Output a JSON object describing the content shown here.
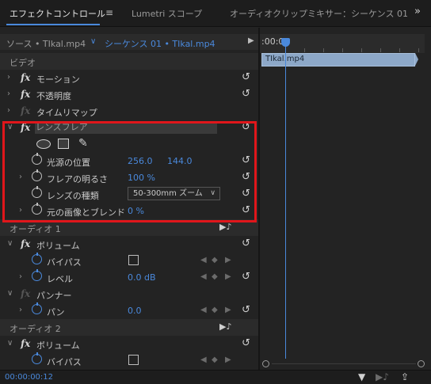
{
  "tabs": {
    "effect_controls": "エフェクトコントロール",
    "menu_icon": "≡",
    "lumetri": "Lumetri スコープ",
    "audio_mixer": "オーディオクリップミキサー：シーケンス 01",
    "more_icon": "»"
  },
  "source": {
    "label": "ソース • TIkal.mp4",
    "sequence": "シーケンス 01 • TIkal.mp4"
  },
  "sections": {
    "video": "ビデオ",
    "audio1": "オーディオ 1",
    "audio2": "オーディオ 2"
  },
  "effects": {
    "fx": "fx",
    "motion": "モーション",
    "opacity": "不透明度",
    "time_remap": "タイムリマップ",
    "lens_flare": "レンズフレア",
    "volume": "ボリューム",
    "volume2": "ボリューム",
    "panner": "パンナー"
  },
  "lens_flare_params": {
    "center_label": "光源の位置",
    "center_x": "256.0",
    "center_y": "144.0",
    "brightness_label": "フレアの明るさ",
    "brightness_value": "100 %",
    "lens_type_label": "レンズの種類",
    "lens_type_value": "50-300mm ズーム",
    "blend_label": "元の画像とブレンド",
    "blend_value": "0 %"
  },
  "audio_params": {
    "bypass": "バイパス",
    "level": "レベル",
    "level_value": "0.0 dB",
    "pan": "パン",
    "pan_value": "0.0",
    "bypass2": "バイパス"
  },
  "timeline": {
    "ruler_label": ":00:00",
    "clip_name": "TIkal.mp4"
  },
  "status": {
    "timecode": "00:00:00:12"
  },
  "accent_color": "#4a89dc",
  "highlight_color": "#e0161b"
}
